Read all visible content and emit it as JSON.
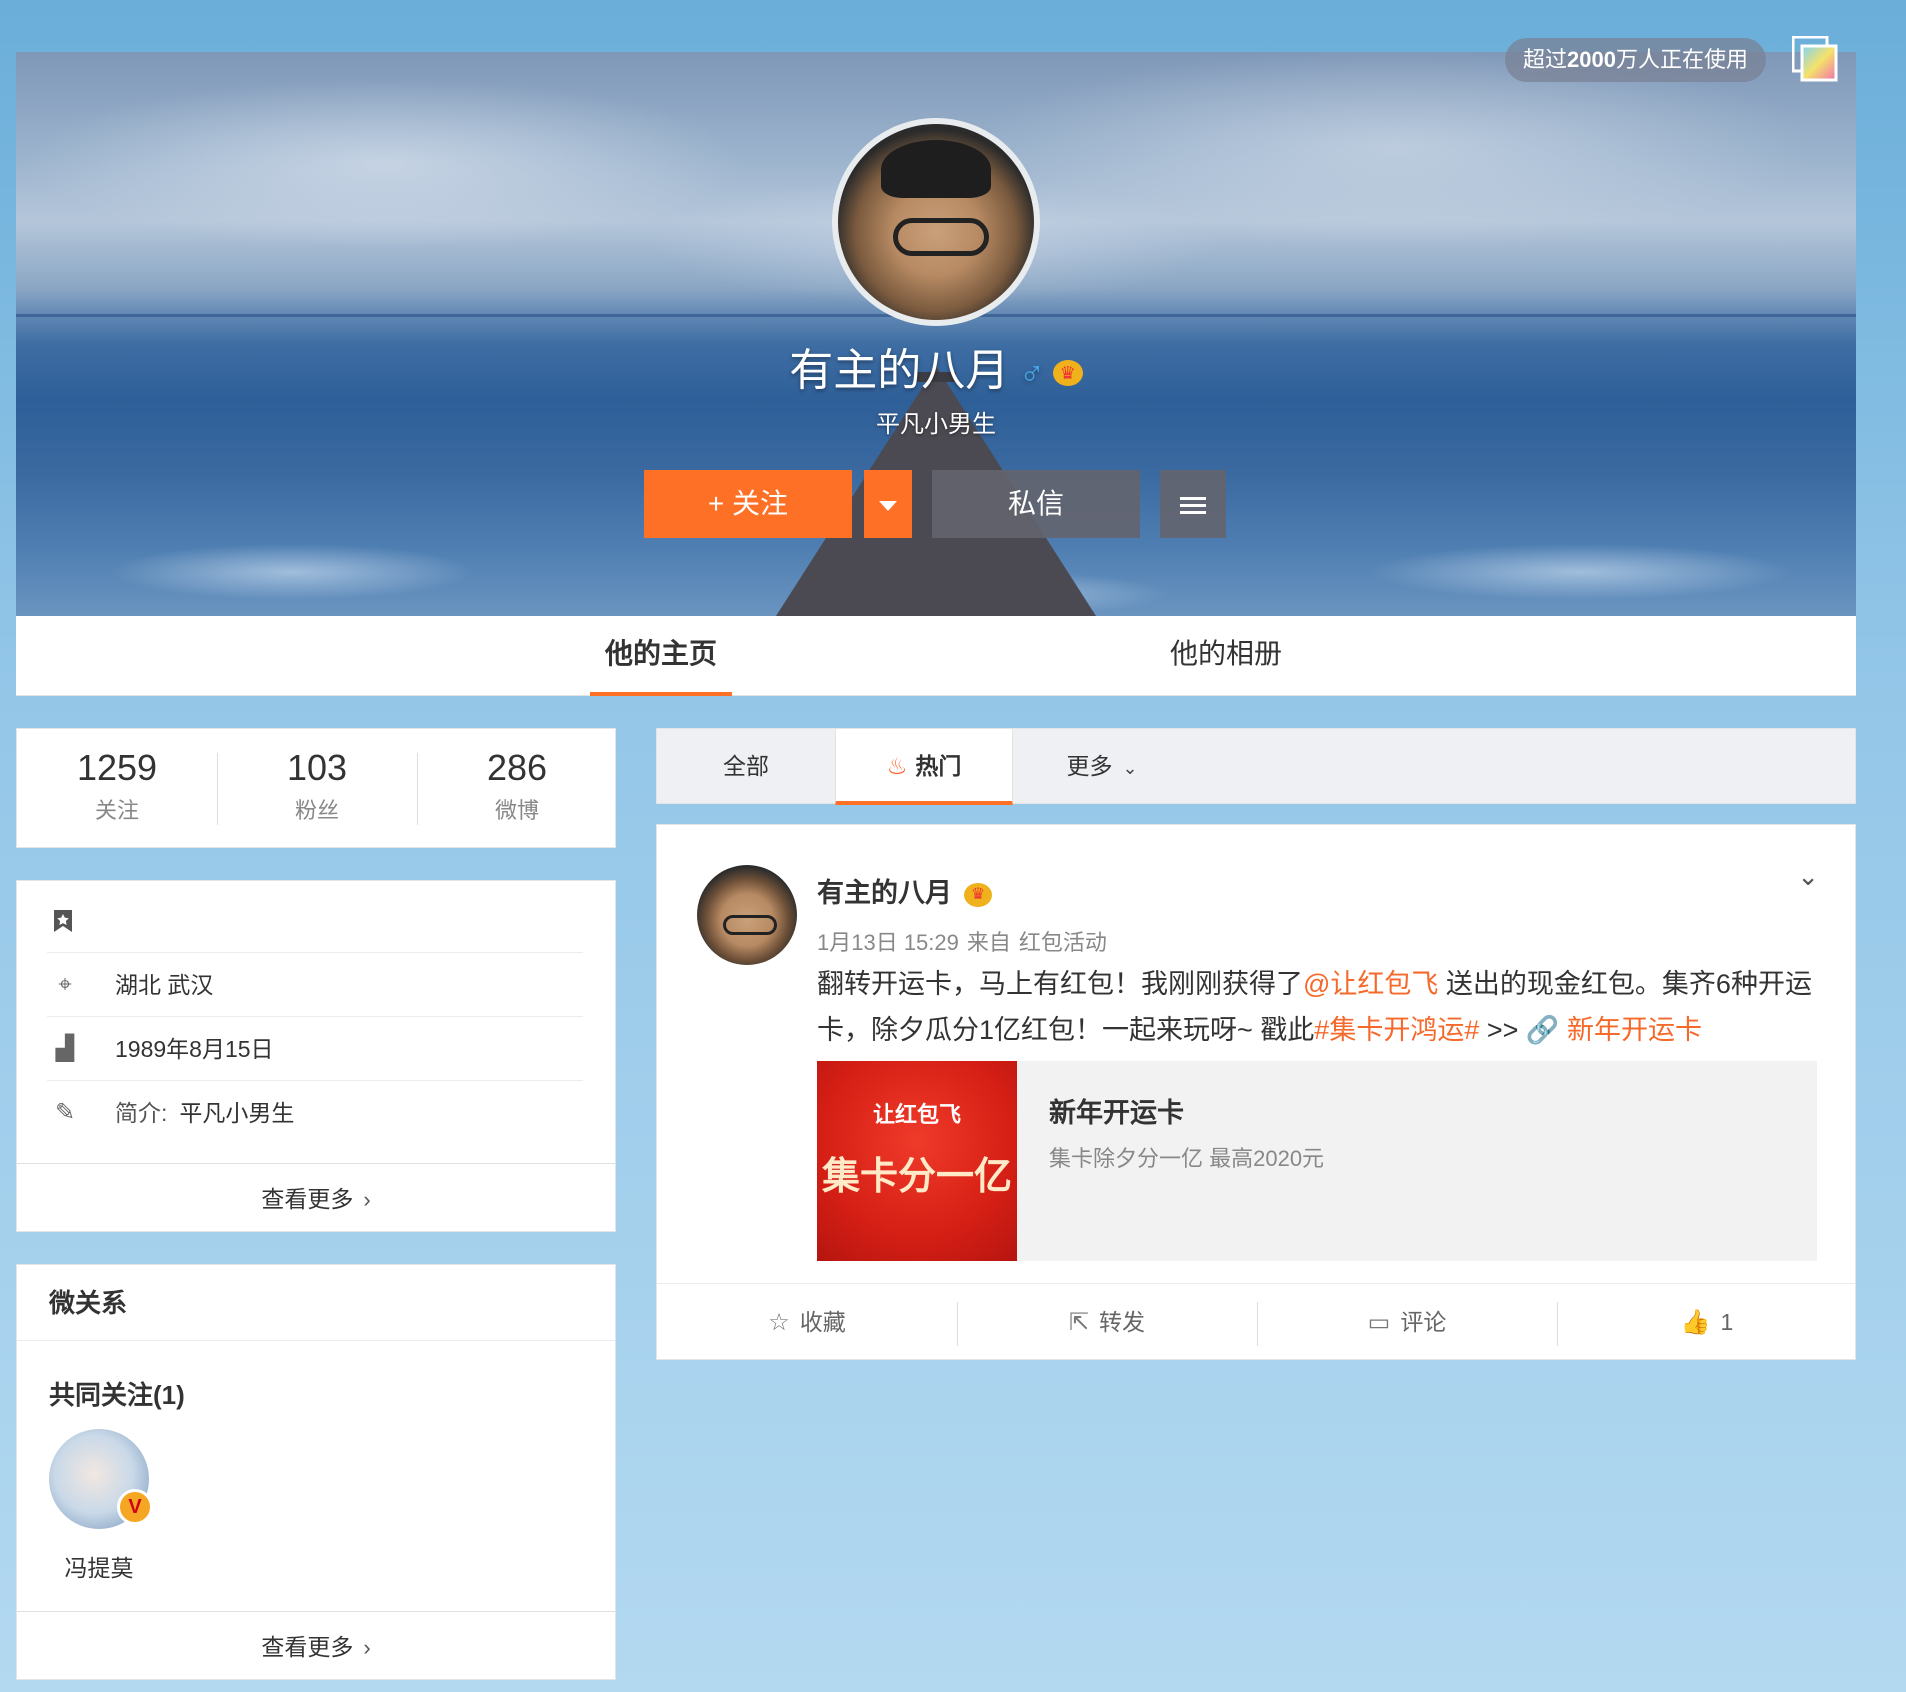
{
  "cover": {
    "users_prefix": "超过",
    "users_bold": "2000",
    "users_suffix": "万人正在使用"
  },
  "profile": {
    "name": "有主的八月",
    "gender_symbol": "♂",
    "vip_badge": "♛",
    "bio": "平凡小男生",
    "follow_label": "+ 关注",
    "message_label": "私信"
  },
  "tabs": {
    "home": "他的主页",
    "album": "他的相册"
  },
  "stats": [
    {
      "value": "1259",
      "label": "关注"
    },
    {
      "value": "103",
      "label": "粉丝"
    },
    {
      "value": "286",
      "label": "微博"
    }
  ],
  "info": {
    "location": "湖北 武汉",
    "birthday": "1989年8月15日",
    "intro_prefix": "简介:",
    "intro": "平凡小男生",
    "more": "查看更多",
    "chevron": "›"
  },
  "relation": {
    "title": "微关系",
    "common": "共同关注(1)",
    "friend_name": "冯提莫",
    "friend_badge": "V",
    "more": "查看更多",
    "chevron": "›"
  },
  "feed_tabs": {
    "all": "全部",
    "hot": "热门",
    "more": "更多"
  },
  "post": {
    "author": "有主的八月",
    "time": "1月13日 15:29",
    "from_label": "来自",
    "source": "红包活动",
    "text_1": "翻转开运卡，马上有红包！我刚刚获得了",
    "mention": "@让红包飞",
    "text_2": " 送出的现金红包。集齐6种开运卡，除夕瓜分1亿红包！一起来玩呀~ 戳此",
    "hashtag": "#集卡开鸿运#",
    "text_3": " >> ",
    "link_text": "🔗 新年开运卡",
    "card_brand": "让红包飞",
    "card_slogan": "集卡分一亿",
    "card_title": "新年开运卡",
    "card_desc": "集卡除夕分一亿 最高2020元",
    "actions": {
      "collect": "收藏",
      "repost": "转发",
      "comment": "评论",
      "like_count": "1"
    }
  },
  "icons": {
    "accent": "#ff7027",
    "link_color": "#f5692a"
  }
}
